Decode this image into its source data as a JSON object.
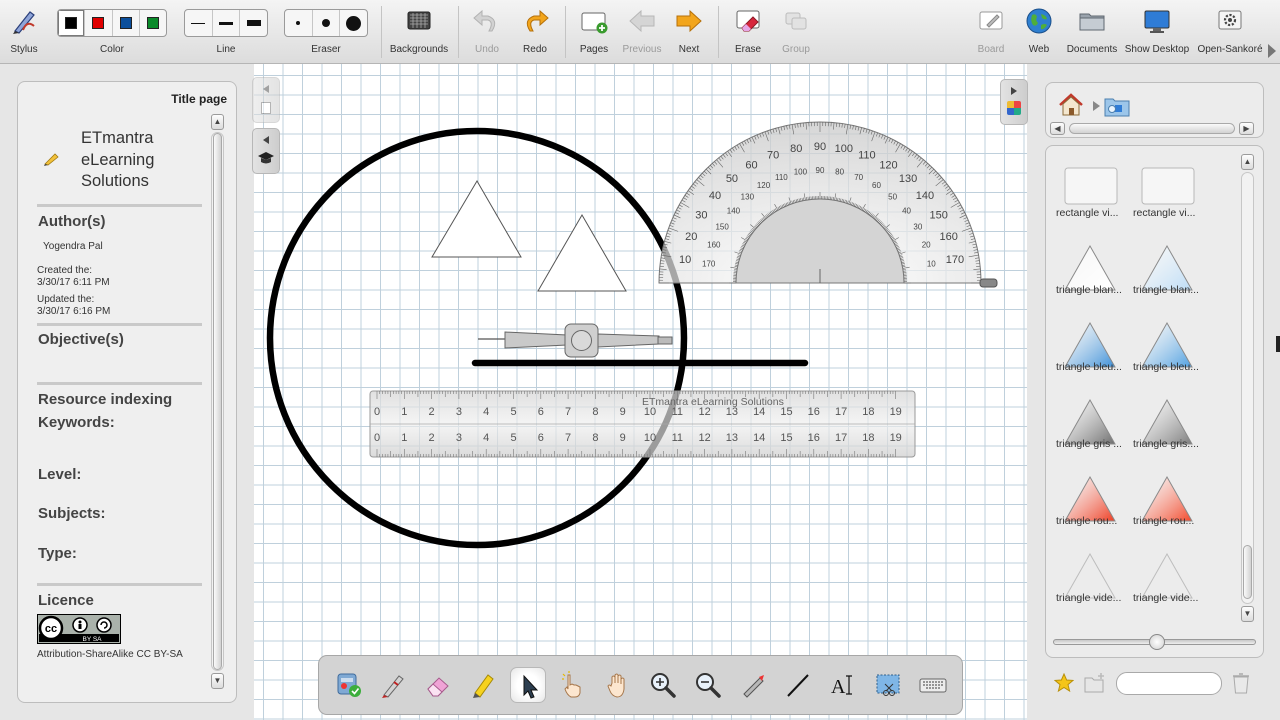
{
  "toolbar": {
    "items": [
      {
        "key": "stylus",
        "label": "Stylus"
      },
      {
        "key": "color",
        "label": "Color"
      },
      {
        "key": "line",
        "label": "Line"
      },
      {
        "key": "eraser",
        "label": "Eraser"
      },
      {
        "key": "backgrounds",
        "label": "Backgrounds"
      },
      {
        "key": "undo",
        "label": "Undo",
        "enabled": false
      },
      {
        "key": "redo",
        "label": "Redo"
      },
      {
        "key": "pages",
        "label": "Pages"
      },
      {
        "key": "previous",
        "label": "Previous",
        "enabled": false
      },
      {
        "key": "next",
        "label": "Next"
      },
      {
        "key": "erase",
        "label": "Erase"
      },
      {
        "key": "group",
        "label": "Group",
        "enabled": false
      },
      {
        "key": "board",
        "label": "Board"
      },
      {
        "key": "web",
        "label": "Web"
      },
      {
        "key": "documents",
        "label": "Documents"
      },
      {
        "key": "show_desktop",
        "label": "Show Desktop"
      },
      {
        "key": "open_sankore",
        "label": "Open-Sankoré"
      }
    ],
    "colors": [
      "#000000",
      "#e00000",
      "#0b4f9c",
      "#0a8a2a"
    ],
    "selected_color_index": 0
  },
  "left_panel": {
    "title_page": "Title page",
    "doc_title": "ETmantra eLearning Solutions",
    "authors_heading": "Author(s)",
    "author": "Yogendra Pal",
    "created_label": "Created the:",
    "created": "3/30/17 6:11 PM",
    "updated_label": "Updated the:",
    "updated": "3/30/17 6:16 PM",
    "objectives_heading": "Objective(s)",
    "resource_heading": "Resource indexing",
    "keywords_label": "Keywords:",
    "level_label": "Level:",
    "subjects_label": "Subjects:",
    "type_label": "Type:",
    "licence_heading": "Licence",
    "licence_text": "Attribution-ShareAlike CC BY-SA",
    "badge_text": "BY  SA"
  },
  "board": {
    "ruler_watermark": "ETmantra eLearning Solutions",
    "ruler_numbers": [
      "0",
      "1",
      "2",
      "3",
      "4",
      "5",
      "6",
      "7",
      "8",
      "9",
      "10",
      "11",
      "12",
      "13",
      "14",
      "15",
      "16",
      "17",
      "18",
      "19"
    ],
    "protractor_outer": [
      "10",
      "20",
      "30",
      "40",
      "50",
      "60",
      "70",
      "80",
      "90",
      "100",
      "110",
      "120",
      "130",
      "140",
      "150",
      "160",
      "170"
    ],
    "protractor_inner": [
      "10",
      "20",
      "30",
      "40",
      "50",
      "60",
      "70",
      "80",
      "90",
      "100",
      "110",
      "120",
      "130",
      "140",
      "150",
      "160",
      "170"
    ]
  },
  "dock": {
    "tools": [
      "select-all-tool",
      "pen-tool",
      "eraser-tool",
      "highlighter-tool",
      "selector-tool",
      "interact-tool",
      "hand-tool",
      "zoom-in-tool",
      "zoom-out-tool",
      "laser-pointer-tool",
      "line-tool",
      "text-tool",
      "capture-tool",
      "virtual-keyboard-tool"
    ],
    "active_index": 4
  },
  "right_panel": {
    "items": [
      {
        "label": "rectangle vi...",
        "kind": "rect",
        "fill": "#f6f6f6"
      },
      {
        "label": "rectangle vi...",
        "kind": "rect",
        "fill": "#f6f6f6"
      },
      {
        "label": "triangle blan...",
        "kind": "tri",
        "fill": "#ffffff"
      },
      {
        "label": "triangle blan...",
        "kind": "tri",
        "fill": "#bcdcf6"
      },
      {
        "label": "triangle bleu...",
        "kind": "tri",
        "fill": "#3c8fd8"
      },
      {
        "label": "triangle bleu...",
        "kind": "tri",
        "fill": "#4f9fe0"
      },
      {
        "label": "triangle gris ...",
        "kind": "tri",
        "fill": "#6d6d6d"
      },
      {
        "label": "triangle gris....",
        "kind": "tri",
        "fill": "#7c7c7c"
      },
      {
        "label": "triangle rou...",
        "kind": "tri",
        "fill": "#ee3d22"
      },
      {
        "label": "triangle rou...",
        "kind": "tri",
        "fill": "#f2482a"
      },
      {
        "label": "triangle vide...",
        "kind": "tri-empty",
        "fill": "none"
      },
      {
        "label": "triangle vide...",
        "kind": "tri-empty",
        "fill": "none"
      }
    ],
    "search_value": ""
  }
}
